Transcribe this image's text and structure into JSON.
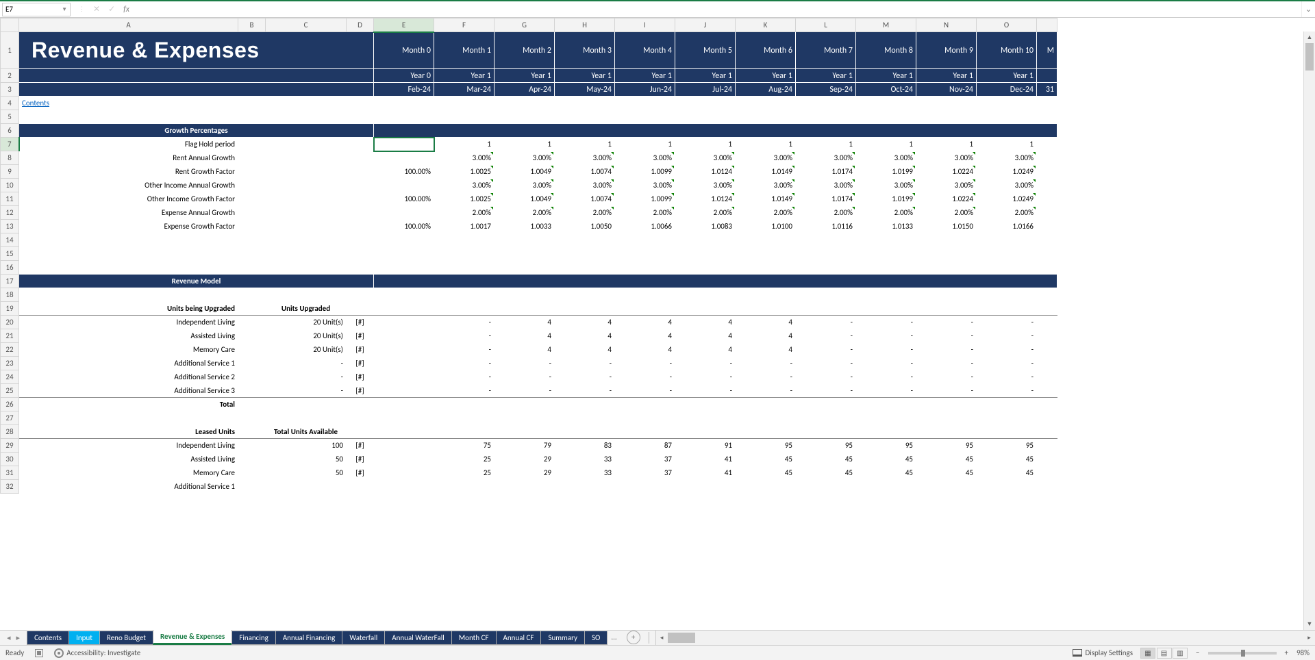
{
  "nameBox": "E7",
  "title": "Revenue & Expenses",
  "contentsLink": "Contents",
  "columns": [
    "A",
    "B",
    "C",
    "D",
    "E",
    "F",
    "G",
    "H",
    "I",
    "J",
    "K",
    "L",
    "M",
    "N",
    "O"
  ],
  "activeColIndex": 4,
  "activeRowIndex": 7,
  "colHeaders": {
    "E": {
      "m": "Month 0",
      "y": "Year 0",
      "d": "Feb-24"
    },
    "F": {
      "m": "Month 1",
      "y": "Year 1",
      "d": "Mar-24"
    },
    "G": {
      "m": "Month 2",
      "y": "Year 1",
      "d": "Apr-24"
    },
    "H": {
      "m": "Month 3",
      "y": "Year 1",
      "d": "May-24"
    },
    "I": {
      "m": "Month 4",
      "y": "Year 1",
      "d": "Jun-24"
    },
    "J": {
      "m": "Month 5",
      "y": "Year 1",
      "d": "Jul-24"
    },
    "K": {
      "m": "Month 6",
      "y": "Year 1",
      "d": "Aug-24"
    },
    "L": {
      "m": "Month 7",
      "y": "Year 1",
      "d": "Sep-24"
    },
    "M": {
      "m": "Month 8",
      "y": "Year 1",
      "d": "Oct-24"
    },
    "N": {
      "m": "Month 9",
      "y": "Year 1",
      "d": "Nov-24"
    },
    "O": {
      "m": "Month 10",
      "y": "Year 1",
      "d": "Dec-24"
    },
    "P": {
      "m": "M",
      "y": "",
      "d": "31"
    }
  },
  "sect1": "Growth Percentages",
  "sect2": "Revenue Model",
  "rows": {
    "r7": {
      "label": "Flag Hold period",
      "E": "",
      "F": "1",
      "G": "1",
      "H": "1",
      "I": "1",
      "J": "1",
      "K": "1",
      "L": "1",
      "M": "1",
      "N": "1",
      "O": "1"
    },
    "r8": {
      "label": "Rent Annual Growth",
      "F": "3.00%",
      "G": "3.00%",
      "H": "3.00%",
      "I": "3.00%",
      "J": "3.00%",
      "K": "3.00%",
      "L": "3.00%",
      "M": "3.00%",
      "N": "3.00%",
      "O": "3.00%"
    },
    "r9": {
      "label": "Rent Growth Factor",
      "E": "100.00%",
      "F": "1.0025",
      "G": "1.0049",
      "H": "1.0074",
      "I": "1.0099",
      "J": "1.0124",
      "K": "1.0149",
      "L": "1.0174",
      "M": "1.0199",
      "N": "1.0224",
      "O": "1.0249"
    },
    "r10": {
      "label": "Other Income Annual Growth",
      "F": "3.00%",
      "G": "3.00%",
      "H": "3.00%",
      "I": "3.00%",
      "J": "3.00%",
      "K": "3.00%",
      "L": "3.00%",
      "M": "3.00%",
      "N": "3.00%",
      "O": "3.00%"
    },
    "r11": {
      "label": "Other Income Growth Factor",
      "E": "100.00%",
      "F": "1.0025",
      "G": "1.0049",
      "H": "1.0074",
      "I": "1.0099",
      "J": "1.0124",
      "K": "1.0149",
      "L": "1.0174",
      "M": "1.0199",
      "N": "1.0224",
      "O": "1.0249"
    },
    "r12": {
      "label": "Expense Annual Growth",
      "F": "2.00%",
      "G": "2.00%",
      "H": "2.00%",
      "I": "2.00%",
      "J": "2.00%",
      "K": "2.00%",
      "L": "2.00%",
      "M": "2.00%",
      "N": "2.00%",
      "O": "2.00%"
    },
    "r13": {
      "label": "Expense Growth Factor",
      "E": "100.00%",
      "F": "1.0017",
      "G": "1.0033",
      "H": "1.0050",
      "I": "1.0066",
      "J": "1.0083",
      "K": "1.0100",
      "L": "1.0116",
      "M": "1.0133",
      "N": "1.0150",
      "O": "1.0166"
    },
    "r19": {
      "label": "Units being Upgraded",
      "C": "Units Upgraded"
    },
    "r20": {
      "label": "Independent Living",
      "C": "20 Unit(s)",
      "D": "[#]",
      "F": "-",
      "G": "4",
      "H": "4",
      "I": "4",
      "J": "4",
      "K": "4",
      "L": "-",
      "M": "-",
      "N": "-",
      "O": "-"
    },
    "r21": {
      "label": "Assisted Living",
      "C": "20 Unit(s)",
      "D": "[#]",
      "F": "-",
      "G": "4",
      "H": "4",
      "I": "4",
      "J": "4",
      "K": "4",
      "L": "-",
      "M": "-",
      "N": "-",
      "O": "-"
    },
    "r22": {
      "label": "Memory Care",
      "C": "20 Unit(s)",
      "D": "[#]",
      "F": "-",
      "G": "4",
      "H": "4",
      "I": "4",
      "J": "4",
      "K": "4",
      "L": "-",
      "M": "-",
      "N": "-",
      "O": "-"
    },
    "r23": {
      "label": "Additional Service 1",
      "C": "-",
      "D": "[#]",
      "F": "-",
      "G": "-",
      "H": "-",
      "I": "-",
      "J": "-",
      "K": "-",
      "L": "-",
      "M": "-",
      "N": "-",
      "O": "-"
    },
    "r24": {
      "label": "Additional Service 2",
      "C": "-",
      "D": "[#]",
      "F": "-",
      "G": "-",
      "H": "-",
      "I": "-",
      "J": "-",
      "K": "-",
      "L": "-",
      "M": "-",
      "N": "-",
      "O": "-"
    },
    "r25": {
      "label": "Additional Service 3",
      "C": "-",
      "D": "[#]",
      "F": "-",
      "G": "-",
      "H": "-",
      "I": "-",
      "J": "-",
      "K": "-",
      "L": "-",
      "M": "-",
      "N": "-",
      "O": "-"
    },
    "r26": {
      "label": "Total"
    },
    "r28": {
      "label": "Leased Units",
      "C": "Total Units Available"
    },
    "r29": {
      "label": "Independent Living",
      "C": "100",
      "D": "[#]",
      "F": "75",
      "G": "79",
      "H": "83",
      "I": "87",
      "J": "91",
      "K": "95",
      "L": "95",
      "M": "95",
      "N": "95",
      "O": "95"
    },
    "r30": {
      "label": "Assisted Living",
      "C": "50",
      "D": "[#]",
      "F": "25",
      "G": "29",
      "H": "33",
      "I": "37",
      "J": "41",
      "K": "45",
      "L": "45",
      "M": "45",
      "N": "45",
      "O": "45"
    },
    "r31": {
      "label": "Memory Care",
      "C": "50",
      "D": "[#]",
      "F": "25",
      "G": "29",
      "H": "33",
      "I": "37",
      "J": "41",
      "K": "45",
      "L": "45",
      "M": "45",
      "N": "45",
      "O": "45"
    },
    "r32": {
      "label": "Additional Service 1"
    }
  },
  "tabs": [
    "Contents",
    "Input",
    "Reno Budget",
    "Revenue & Expenses",
    "Financing",
    "Annual Financing",
    "Waterfall",
    "Annual WaterFall",
    "Month CF",
    "Annual CF",
    "Summary",
    "SO"
  ],
  "tabMore": "...",
  "status": {
    "ready": "Ready",
    "access": "Accessibility: Investigate",
    "disp": "Display Settings",
    "zoom": "98%"
  }
}
